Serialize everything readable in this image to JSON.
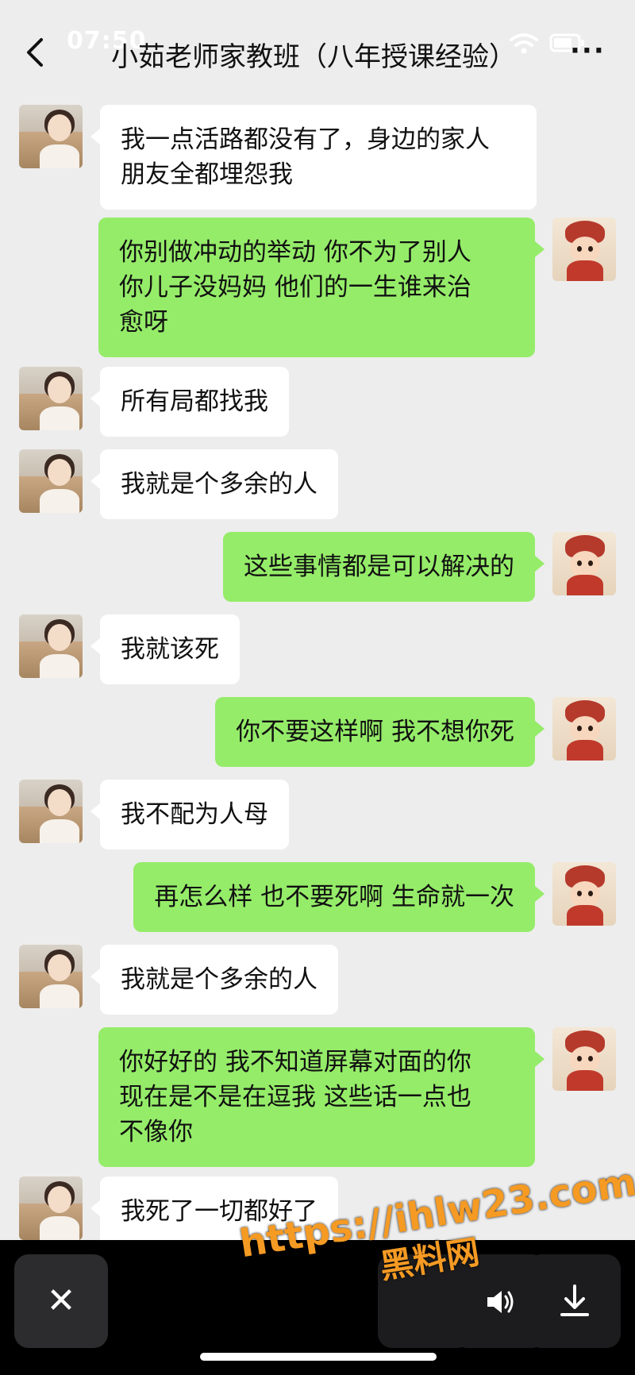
{
  "status": {
    "time": "07:50"
  },
  "header": {
    "title": "小茹老师家教班（八年授课经验）",
    "more": "···"
  },
  "messages": [
    {
      "side": "in",
      "text": "我一点活路都没有了，身边的家人\n朋友全都埋怨我"
    },
    {
      "side": "out",
      "text": "你别做冲动的举动 你不为了别人\n你儿子没妈妈 他们的一生谁来治\n愈呀"
    },
    {
      "side": "in",
      "text": "所有局都找我"
    },
    {
      "side": "in",
      "text": "我就是个多余的人"
    },
    {
      "side": "out",
      "text": "这些事情都是可以解决的"
    },
    {
      "side": "in",
      "text": "我就该死"
    },
    {
      "side": "out",
      "text": "你不要这样啊 我不想你死"
    },
    {
      "side": "in",
      "text": "我不配为人母"
    },
    {
      "side": "out",
      "text": "再怎么样 也不要死啊 生命就一次"
    },
    {
      "side": "in",
      "text": "我就是个多余的人"
    },
    {
      "side": "out",
      "text": "你好好的 我不知道屏幕对面的你\n现在是不是在逗我 这些话一点也\n不像你"
    },
    {
      "side": "in",
      "text": "我死了一切都好了"
    }
  ],
  "bottom_bar": {
    "close": "✕"
  },
  "watermark": {
    "url": "https://ihlw23.com",
    "site": "黑料网"
  },
  "colors": {
    "bubble_out": "#95ec69",
    "bubble_in": "#ffffff",
    "background": "#ededed",
    "watermark": "#f59a23"
  }
}
